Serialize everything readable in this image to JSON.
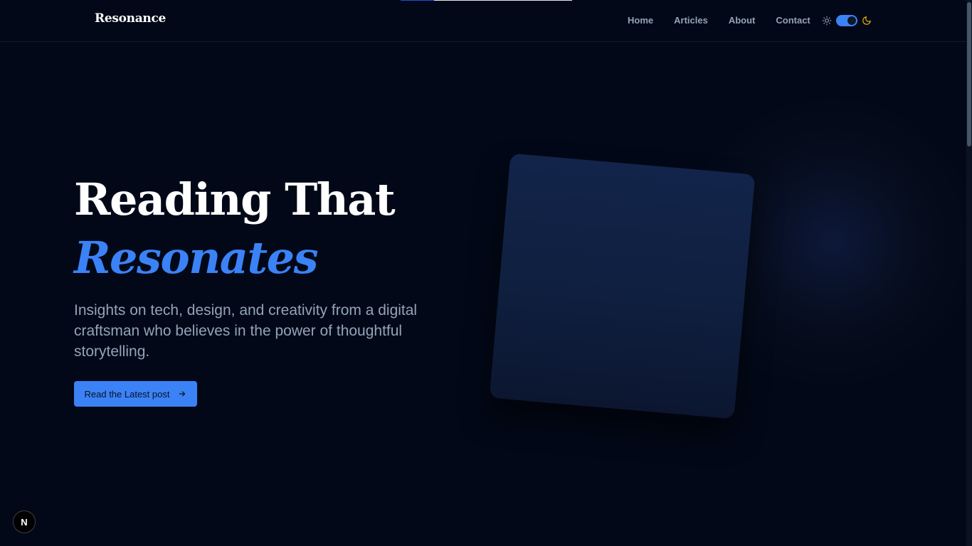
{
  "header": {
    "brand": "Resonance",
    "nav": [
      "Home",
      "Articles",
      "About",
      "Contact"
    ]
  },
  "theme_toggle": {
    "sun_icon": "sun-icon",
    "moon_icon": "moon-icon",
    "state": "dark"
  },
  "hero": {
    "title_line1": "Reading That",
    "title_line2": "Resonates",
    "subtitle": "Insights on tech, design, and creativity from a digital craftsman who believes in the power of thoughtful storytelling.",
    "cta_label": "Read the Latest post",
    "cta_icon": "arrow-right-icon"
  },
  "badge": {
    "label": "N",
    "icon": "nextjs-icon"
  },
  "colors": {
    "background": "#020817",
    "accent": "#3b82f6",
    "text_primary": "#ffffff",
    "text_muted": "#94a3b8",
    "moon": "#eab308"
  }
}
